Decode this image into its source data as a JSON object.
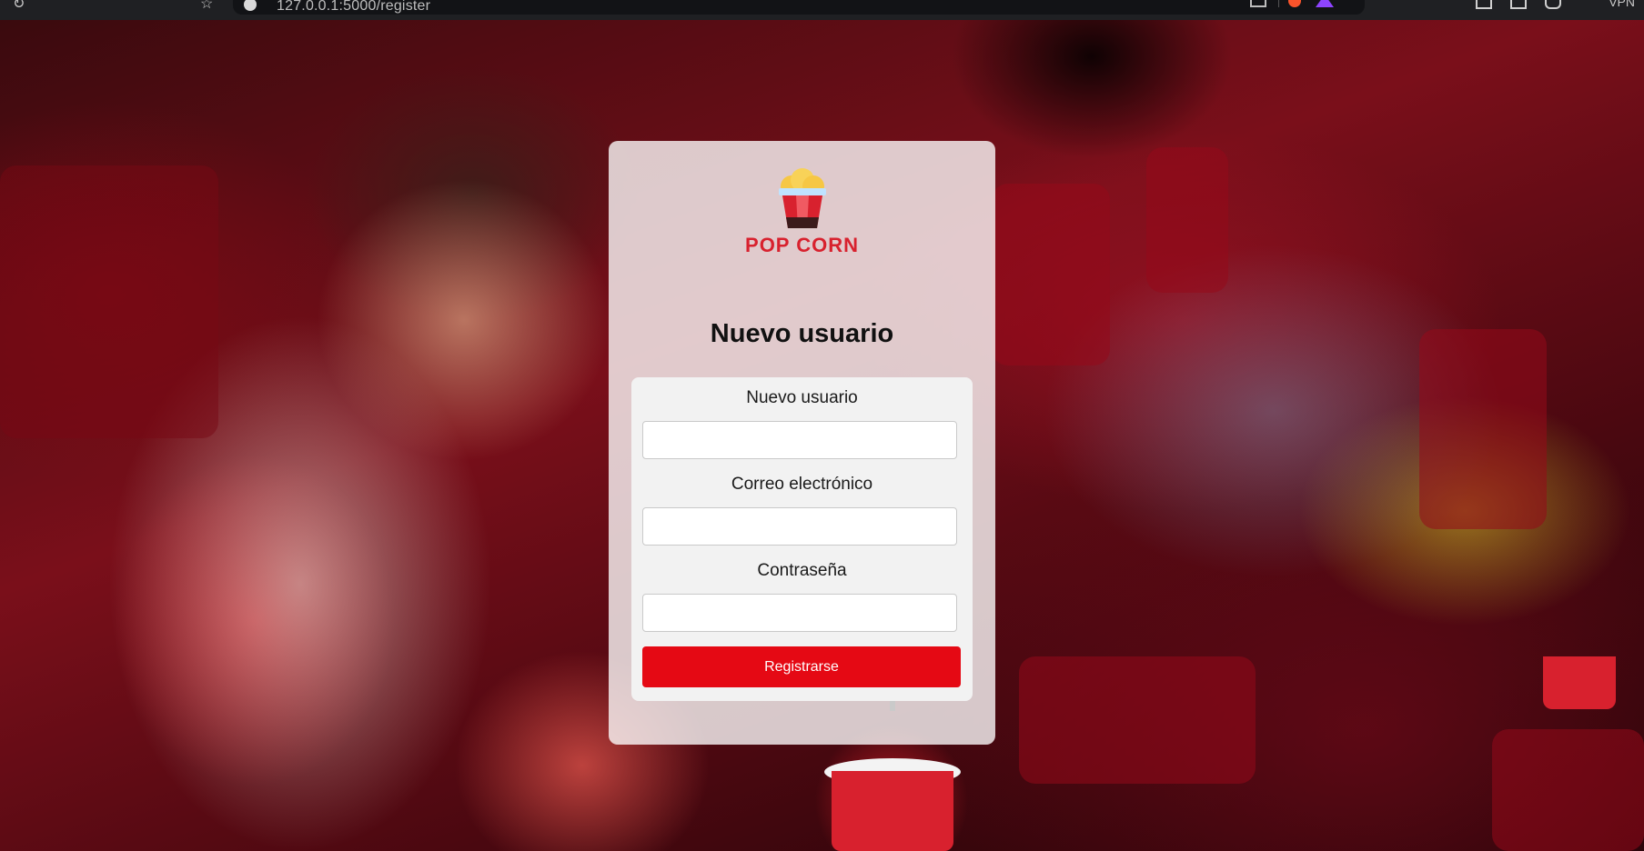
{
  "browser": {
    "url": "127.0.0.1:5000/register",
    "vpn_label": "VPN"
  },
  "logo": {
    "brand_text": "POP CORN",
    "colors": {
      "red": "#d8212e",
      "yellow": "#f6c744",
      "dark": "#3b1b1b"
    }
  },
  "form": {
    "title": "Nuevo usuario",
    "fields": [
      {
        "label": "Nuevo usuario",
        "value": "",
        "type": "text"
      },
      {
        "label": "Correo electrónico",
        "value": "",
        "type": "email"
      },
      {
        "label": "Contraseña",
        "value": "",
        "type": "password"
      }
    ],
    "submit_label": "Registrarse",
    "accent_color": "#e50914"
  }
}
